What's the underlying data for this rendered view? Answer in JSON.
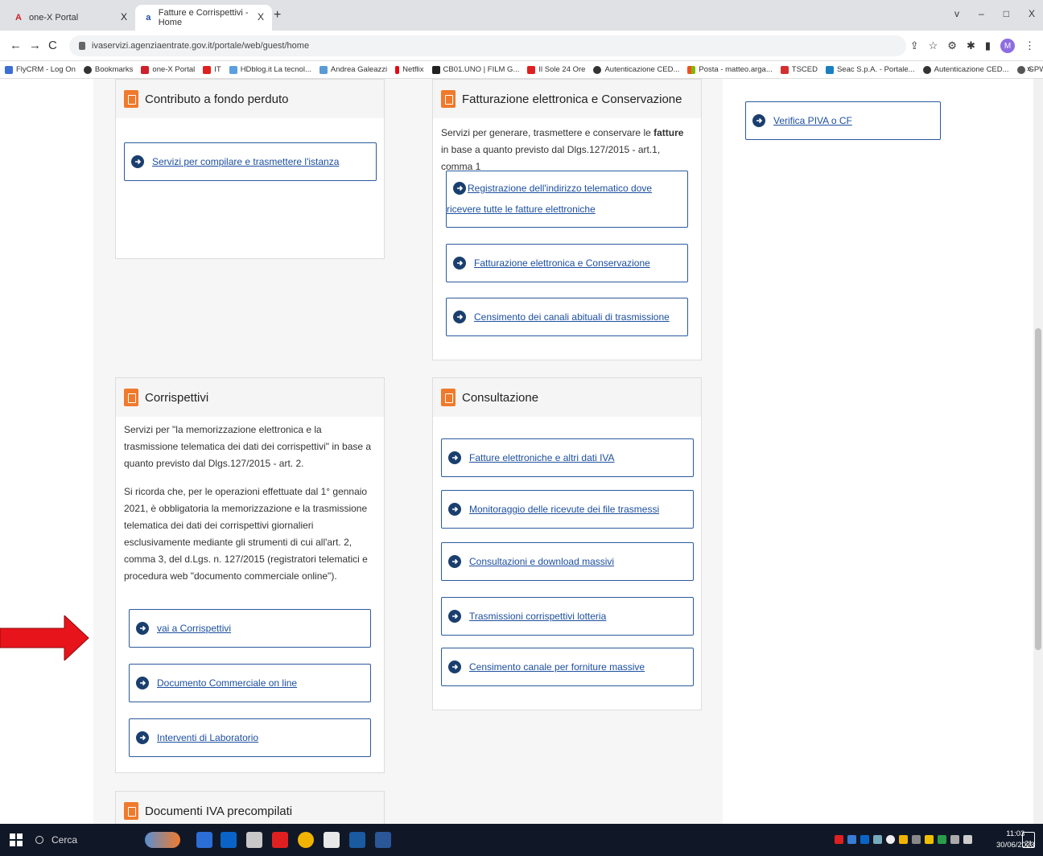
{
  "browser": {
    "tabs": [
      {
        "title": "one-X Portal",
        "close": "X"
      },
      {
        "title": "Fatture e Corrispettivi - Home",
        "close": "X"
      }
    ],
    "new_tab": "+",
    "window_controls": [
      "v",
      "–",
      "□",
      "X"
    ],
    "url": "ivaservizi.agenziaentrate.gov.it/portale/web/guest/home",
    "profile_initial": "M",
    "bookmarks": [
      "FlyCRM - Log On",
      "Bookmarks",
      "one-X Portal",
      "IT",
      "HDblog.it La tecnol...",
      "Andrea Galeazzi",
      "Netflix",
      "CB01.UNO | FILM G...",
      "Il Sole 24 Ore",
      "Autenticazione CED...",
      "Posta - matteo.arga...",
      "TSCED",
      "Seac S.p.A. - Portale...",
      "Autenticazione CED...",
      "GPWEB"
    ],
    "bookmarks_more": "»"
  },
  "cards": {
    "contributo": {
      "title": "Contributo a fondo perduto",
      "links": [
        "Servizi per compilare e trasmettere l'istanza"
      ]
    },
    "fatturazione": {
      "title": "Fatturazione elettronica e Conservazione",
      "text_before": "Servizi per generare, trasmettere e conservare le ",
      "text_bold": "fatture",
      "text_after": " in base a quanto previsto dal Dlgs.127/2015 - art.1, comma 1",
      "links": [
        "Registrazione dell'indirizzo telematico dove ricevere tutte le fatture elettroniche",
        "Fatturazione elettronica e Conservazione",
        "Censimento dei canali abituali di trasmissione"
      ]
    },
    "verifica": {
      "links": [
        "Verifica PIVA o CF"
      ]
    },
    "corrispettivi": {
      "title": "Corrispettivi",
      "text1": "Servizi per \"la memorizzazione elettronica e la trasmissione telematica dei dati dei corrispettivi\" in base a quanto previsto dal Dlgs.127/2015 - art. 2.",
      "text2": "Si ricorda che, per le operazioni effettuate dal 1° gennaio 2021, è obbligatoria la memorizzazione e la trasmissione telematica dei dati dei corrispettivi giornalieri esclusivamente mediante gli strumenti di cui all'art. 2, comma 3, del d.Lgs. n. 127/2015 (registratori telematici e procedura web \"documento commerciale online\").",
      "links": [
        "vai a Corrispettivi",
        "Documento Commerciale on line",
        "Interventi di Laboratorio"
      ]
    },
    "consultazione": {
      "title": "Consultazione",
      "links": [
        "Fatture elettroniche e altri dati IVA",
        "Monitoraggio delle ricevute dei file trasmessi",
        "Consultazioni e download massivi",
        "Trasmissioni corrispettivi lotteria",
        "Censimento canale per forniture massive"
      ]
    },
    "documenti": {
      "title": "Documenti IVA precompilati"
    }
  },
  "taskbar": {
    "search_placeholder": "Cerca",
    "time": "11:03",
    "date": "30/06/2023",
    "notifications": "21"
  },
  "colors": {
    "accent_orange": "#f07a2b",
    "link_blue": "#1d4fa0",
    "annotation_red": "#e8141b"
  }
}
